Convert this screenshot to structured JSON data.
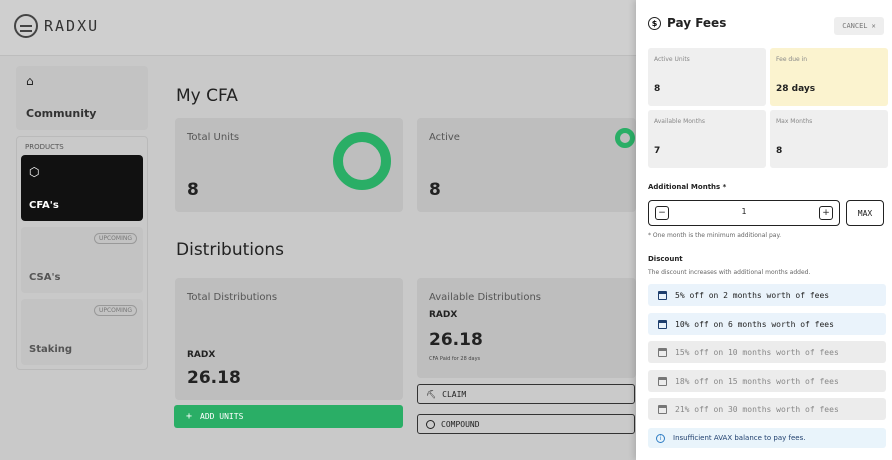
{
  "app": {
    "logo_text": "RADXU"
  },
  "sidebar": {
    "community_label": "Community",
    "products_label": "PRODUCTS",
    "items": [
      {
        "label": "CFA's",
        "active": true,
        "badge": ""
      },
      {
        "label": "CSA's",
        "active": false,
        "badge": "UPCOMING"
      },
      {
        "label": "Staking",
        "active": false,
        "badge": "UPCOMING"
      }
    ]
  },
  "main": {
    "title": "My CFA",
    "total_units": {
      "label": "Total Units",
      "value": "8"
    },
    "active": {
      "label": "Active",
      "value": "8"
    },
    "distributions_title": "Distributions",
    "total_distributions": {
      "label": "Total Distributions",
      "unit": "RADX",
      "value": "26.18"
    },
    "available_distributions": {
      "label": "Available Distributions",
      "unit": "RADX",
      "value": "26.18",
      "note": "CFA Paid for 28 days"
    },
    "add_units_label": "ADD UNITS",
    "claim_label": "CLAIM",
    "compound_label": "COMPOUND"
  },
  "drawer": {
    "title": "Pay Fees",
    "cancel_label": "CANCEL",
    "stats": {
      "active_units": {
        "label": "Active Units",
        "value": "8"
      },
      "fee_due": {
        "label": "Fee due in",
        "value": "28 days"
      },
      "available_months": {
        "label": "Available Months",
        "value": "7"
      },
      "max_months": {
        "label": "Max Months",
        "value": "8"
      }
    },
    "additional_months_label": "Additional Months *",
    "additional_months_value": "1",
    "max_label": "MAX",
    "min_note": "* One month is the minimum additional pay.",
    "discount_label": "Discount",
    "discount_desc": "The discount increases with additional months added.",
    "discounts": [
      {
        "text": "5% off on 2 months worth of fees",
        "enabled": true
      },
      {
        "text": "10% off on 6 months worth of fees",
        "enabled": true
      },
      {
        "text": "15% off on 10 months worth of fees",
        "enabled": false
      },
      {
        "text": "18% off on 15 months worth of fees",
        "enabled": false
      },
      {
        "text": "21% off on 30 months worth of fees",
        "enabled": false
      }
    ],
    "alert": "Insufficient AVAX balance to pay fees."
  },
  "colors": {
    "accent_green": "#2aae66",
    "fee_highlight": "#fbf3cf",
    "info_blue": "#2f7dc4"
  }
}
